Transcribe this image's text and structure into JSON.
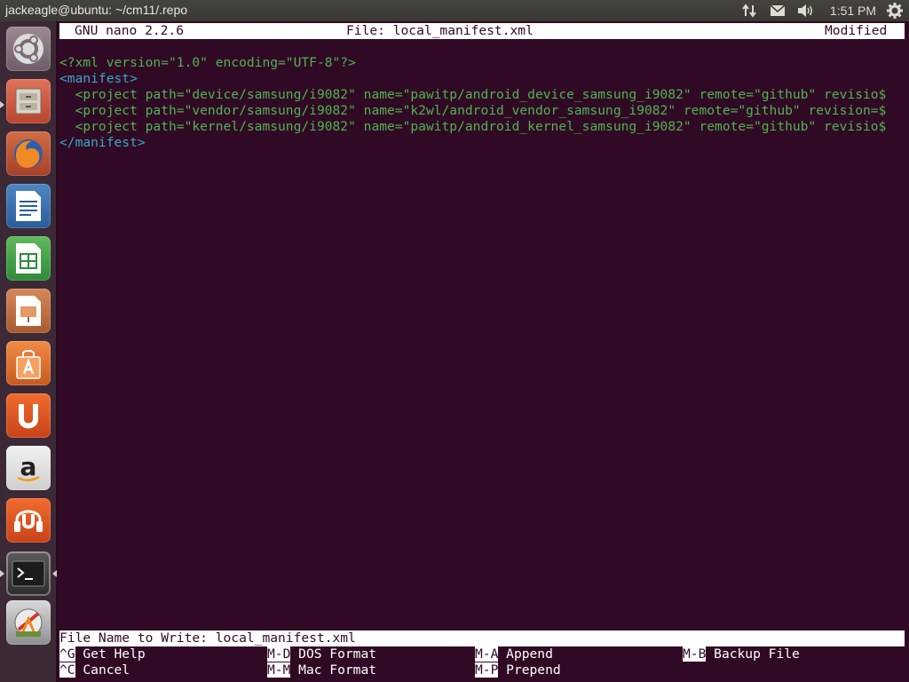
{
  "topbar": {
    "window_title": "jackeagle@ubuntu: ~/cm11/.repo",
    "clock": "1:51 PM",
    "icons": [
      "network-icon",
      "mail-icon",
      "volume-icon",
      "system-gear-icon"
    ]
  },
  "launcher": {
    "items": [
      {
        "name": "ubuntu-dash",
        "icon": "ubuntu-logo-icon"
      },
      {
        "name": "files",
        "icon": "file-cabinet-icon"
      },
      {
        "name": "firefox",
        "icon": "firefox-icon"
      },
      {
        "name": "libreoffice-writer",
        "icon": "writer-document-icon"
      },
      {
        "name": "libreoffice-calc",
        "icon": "calc-spreadsheet-icon"
      },
      {
        "name": "libreoffice-impress",
        "icon": "impress-presentation-icon"
      },
      {
        "name": "ubuntu-software-center",
        "icon": "shopping-bag-icon"
      },
      {
        "name": "ubuntu-one",
        "icon": "ubuntu-one-icon"
      },
      {
        "name": "amazon",
        "icon": "amazon-icon"
      },
      {
        "name": "ubuntu-one-music",
        "icon": "music-headphones-icon"
      },
      {
        "name": "terminal",
        "icon": "terminal-icon"
      },
      {
        "name": "system-updates",
        "icon": "update-icon"
      }
    ]
  },
  "nano": {
    "version": "GNU nano 2.2.6",
    "file": "File: local_manifest.xml",
    "status": "Modified",
    "lines": [
      "<?xml version=\"1.0\" encoding=\"UTF-8\"?>",
      "<manifest>",
      "  <project path=\"device/samsung/i9082\" name=\"pawitp/android_device_samsung_i9082\" remote=\"github\" revisio$",
      "  <project path=\"vendor/samsung/i9082\" name=\"k2wl/android_vendor_samsung_i9082\" remote=\"github\" revision=$",
      "  <project path=\"kernel/samsung/i9082\" name=\"pawitp/android_kernel_samsung_i9082\" remote=\"github\" revisio$",
      "</manifest>"
    ],
    "prompt": "File Name to Write: local_manifest.xml",
    "shortcuts": [
      {
        "key": "^G",
        "label": "Get Help"
      },
      {
        "key": "M-D",
        "label": "DOS Format"
      },
      {
        "key": "M-A",
        "label": "Append"
      },
      {
        "key": "M-B",
        "label": "Backup File"
      },
      {
        "key": "^C",
        "label": "Cancel"
      },
      {
        "key": "M-M",
        "label": "Mac Format"
      },
      {
        "key": "M-P",
        "label": "Prepend"
      }
    ]
  },
  "colors": {
    "terminal_bg": "#300a24",
    "xml_text": "#52b352",
    "xml_tag": "#3ba6c9"
  }
}
